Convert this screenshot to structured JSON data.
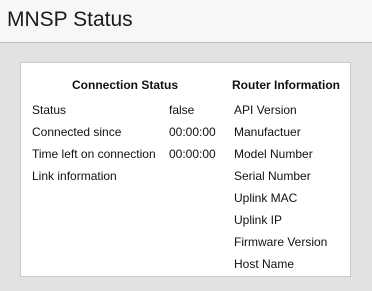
{
  "window": {
    "title": "MNSP Status"
  },
  "connection": {
    "header": "Connection Status",
    "rows": [
      {
        "label": "Status",
        "value": "false"
      },
      {
        "label": "Connected since",
        "value": "00:00:00"
      },
      {
        "label": "Time left on connection",
        "value": "00:00:00"
      },
      {
        "label": "Link information",
        "value": ""
      }
    ]
  },
  "router": {
    "header": "Router Information",
    "fields": [
      "API Version",
      "Manufactuer",
      "Model Number",
      "Serial Number",
      "Uplink MAC",
      "Uplink IP",
      "Firmware Version",
      "Host Name"
    ]
  },
  "colors": {
    "background": "#e2e2e2",
    "title_bar": "#f7f7f7",
    "panel": "#ffffff",
    "border": "#c9c9c9"
  }
}
